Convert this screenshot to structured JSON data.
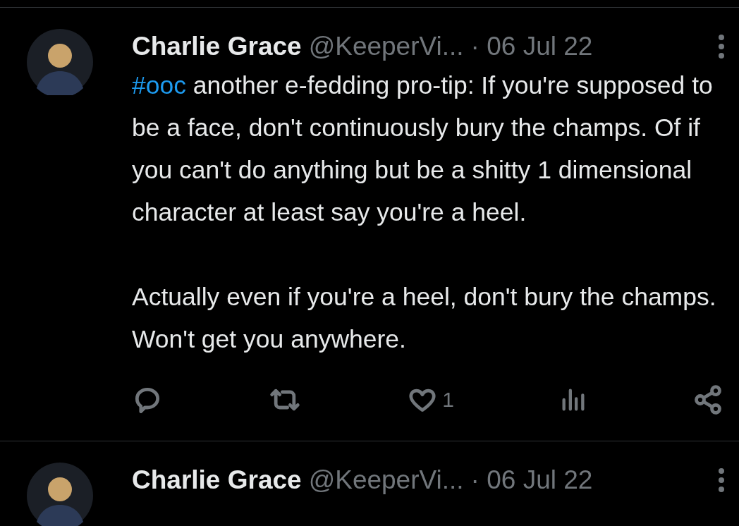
{
  "tweets": [
    {
      "name": "Charlie Grace",
      "handle": "@KeeperVi...",
      "date": "· 06 Jul 22",
      "hashtag": "#ooc",
      "paragraphs": [
        "another e-fedding pro-tip: If you're supposed to be a face, don't continuously bury the champs. Of if you can't do anything but be a shitty 1 dimensional character at least say you're a heel.",
        "Actually even if you're a heel, don't bury the champs. Won't get you anywhere."
      ],
      "likes": "1"
    },
    {
      "name": "Charlie Grace",
      "handle": "@KeeperVi...",
      "date": "· 06 Jul 22"
    }
  ]
}
